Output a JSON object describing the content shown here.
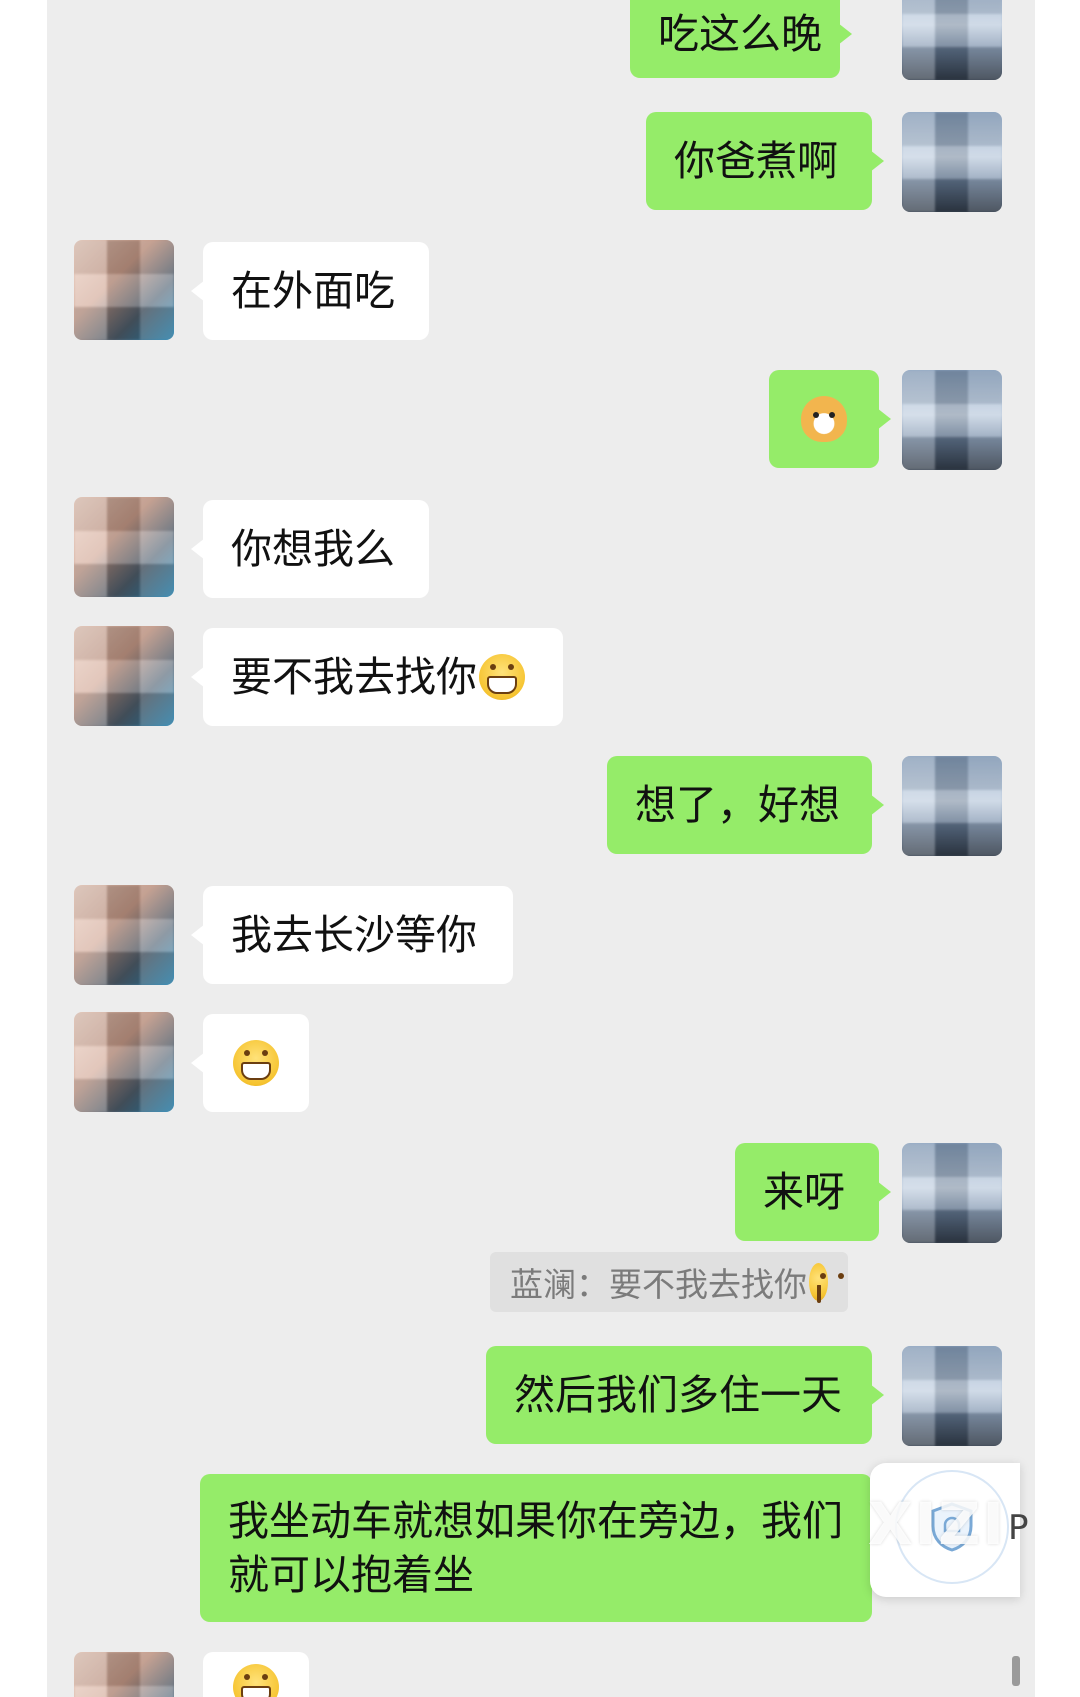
{
  "messages": [
    {
      "side": "right",
      "text": "吃这么晚"
    },
    {
      "side": "right",
      "text": "你爸煮啊"
    },
    {
      "side": "left",
      "text": "在外面吃"
    },
    {
      "side": "right",
      "emoji": "doge"
    },
    {
      "side": "left",
      "text": "你想我么"
    },
    {
      "side": "left",
      "text": "要不我去找你",
      "emoji": "grin"
    },
    {
      "side": "right",
      "text": "想了，好想"
    },
    {
      "side": "left",
      "text": "我去长沙等你"
    },
    {
      "side": "left",
      "emoji": "grin"
    },
    {
      "side": "right",
      "text": "来呀"
    },
    {
      "side": "right",
      "quote": "蓝澜：要不我去找你",
      "emoji": "grin"
    },
    {
      "side": "right",
      "text": "然后我们多住一天"
    },
    {
      "side": "right",
      "text_line1": "我坐动车就想如果你在旁边，我们",
      "text_line2": "就可以抱着坐"
    },
    {
      "side": "left",
      "emoji": "grin"
    }
  ],
  "overlay": {
    "watermark": "XIZI",
    "label": "P"
  },
  "colors": {
    "chat_bg": "#ededed",
    "green_bubble": "#95ec69",
    "white_bubble": "#ffffff"
  }
}
